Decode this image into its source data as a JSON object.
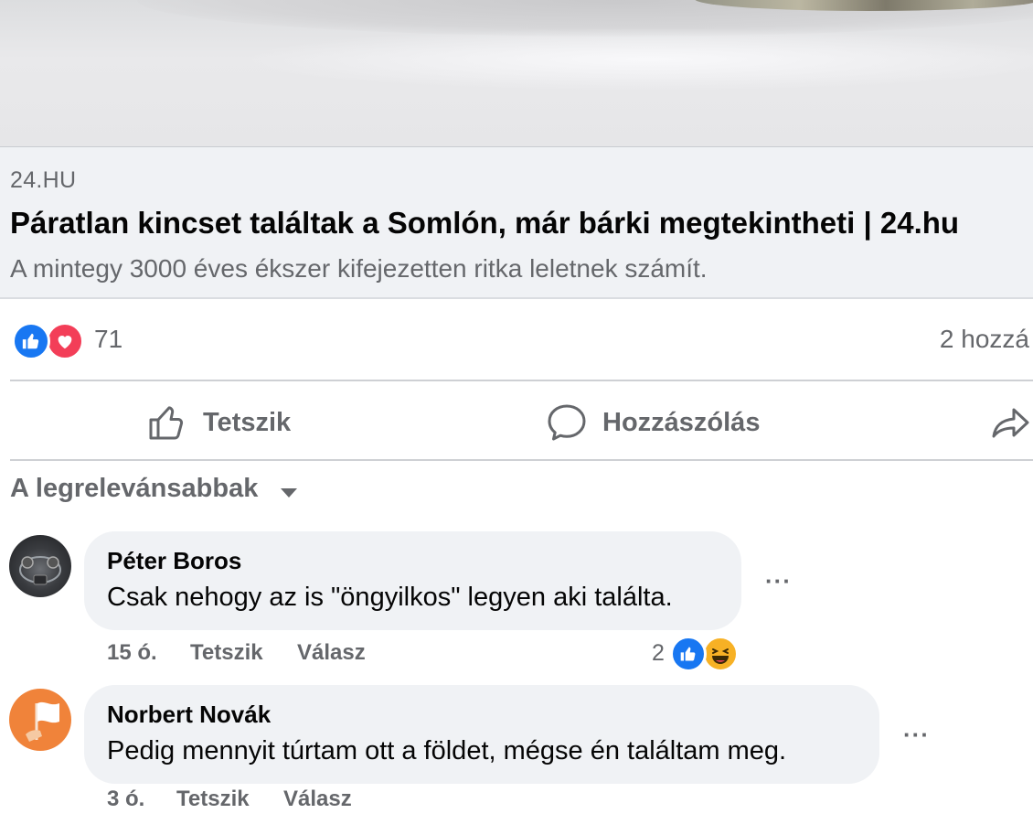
{
  "link_preview": {
    "domain": "24.HU",
    "title": "Páratlan kincset találtak a Somlón, már bárki megtekintheti | 24.hu",
    "description": "A mintegy 3000 éves ékszer kifejezetten ritka leletnek számít."
  },
  "reactions": {
    "count": "71",
    "types": [
      "like-icon",
      "love-icon"
    ],
    "comments_summary": "2 hozzá"
  },
  "actions": {
    "like_label": "Tetszik",
    "comment_label": "Hozzászólás"
  },
  "sort": {
    "label": "A legrelevánsabbak"
  },
  "comments": [
    {
      "author": "Péter Boros",
      "text": "Csak nehogy az is \"öngyilkos\" legyen aki találta.",
      "time": "15 ó.",
      "like_label": "Tetszik",
      "reply_label": "Válasz",
      "reaction_count": "2",
      "reaction_types": [
        "like-icon",
        "haha-icon"
      ],
      "more": "···"
    },
    {
      "author": "Norbert Novák",
      "text": "Pedig mennyit túrtam ott a földet, mégse én találtam meg.",
      "time": "3 ó.",
      "like_label": "Tetszik",
      "reply_label": "Válasz",
      "more": "···"
    }
  ],
  "colors": {
    "accent_blue": "#1877f2",
    "love_red": "#f33e58",
    "secondary_text": "#65676b",
    "bubble_bg": "#f0f2f5",
    "avatar_orange": "#f0833a"
  }
}
